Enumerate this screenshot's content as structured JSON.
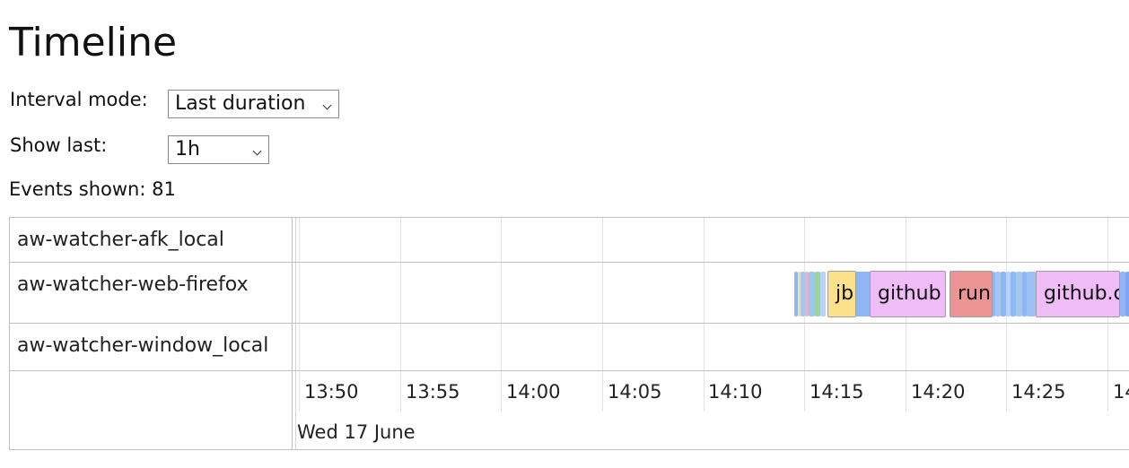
{
  "page": {
    "title": "Timeline"
  },
  "controls": {
    "interval_mode_label": "Interval mode:",
    "interval_mode_value": "Last duration",
    "show_last_label": "Show last:",
    "show_last_value": "1h",
    "events_shown": "Events shown: 81"
  },
  "timeline": {
    "rows": [
      "aw-watcher-afk_local",
      "aw-watcher-web-firefox",
      "aw-watcher-window_local"
    ],
    "ticks": [
      "13:50",
      "13:55",
      "14:00",
      "14:05",
      "14:10",
      "14:15",
      "14:20",
      "14:25",
      "14"
    ],
    "date": "Wed 17 June",
    "events": [
      {
        "label": "jb",
        "color": "#fde08a"
      },
      {
        "label": "github",
        "color": "#efbcf7"
      },
      {
        "label": "run",
        "color": "#ec9394"
      },
      {
        "label": "github.c",
        "color": "#efbcf7"
      }
    ],
    "small_event_colors": [
      "#8fb7f5",
      "#a4c7f0",
      "#9dd39e",
      "#e5b3c6",
      "#f8de8a",
      "#7fa6ee"
    ]
  }
}
